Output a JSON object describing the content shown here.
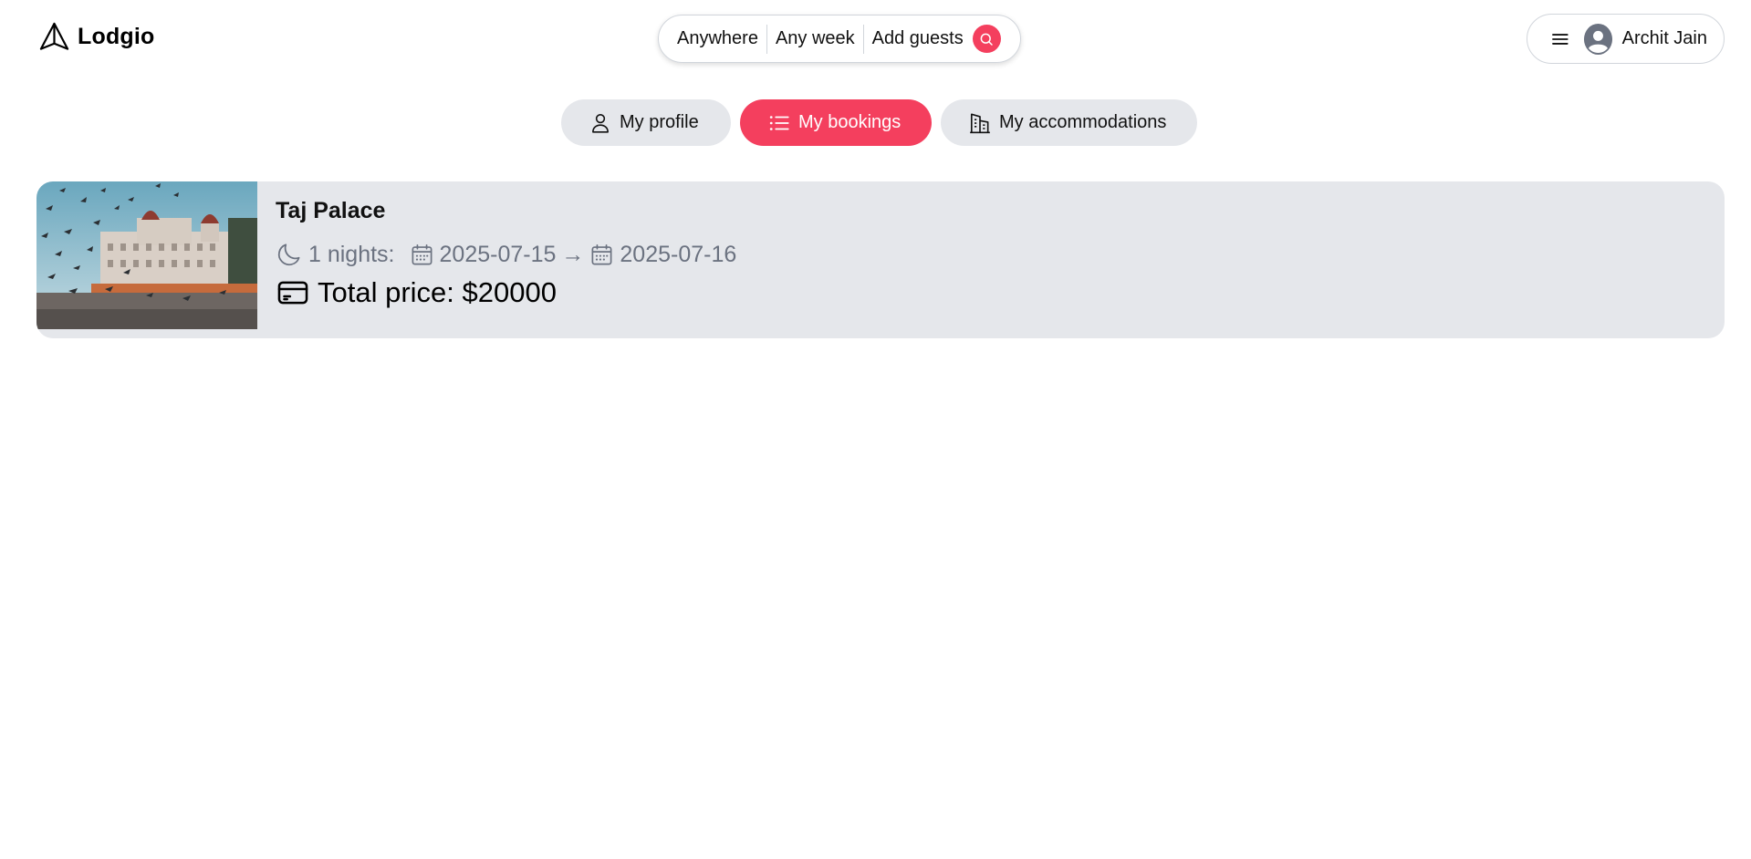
{
  "header": {
    "logo_text": "Lodgio",
    "search": {
      "where": "Anywhere",
      "when": "Any week",
      "who": "Add guests"
    },
    "user_name": "Archit Jain"
  },
  "account_nav": {
    "tabs": [
      {
        "label": "My profile",
        "icon": "user-icon",
        "active": false
      },
      {
        "label": "My bookings",
        "icon": "list-icon",
        "active": true
      },
      {
        "label": "My accommodations",
        "icon": "building-icon",
        "active": false
      }
    ]
  },
  "bookings": [
    {
      "title": "Taj Palace",
      "nights_text": "1 nights:",
      "check_in": "2025-07-15",
      "arrow": "→",
      "check_out": "2025-07-16",
      "price_text": "Total price: $20000"
    }
  ],
  "colors": {
    "accent": "#f43f5e",
    "pill_bg": "#e5e7eb",
    "muted_text": "#6b7280"
  }
}
